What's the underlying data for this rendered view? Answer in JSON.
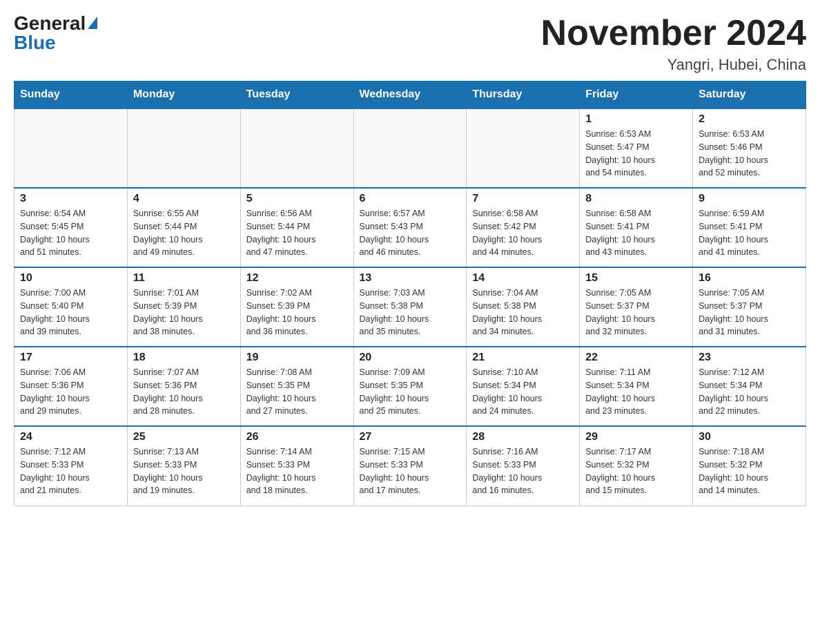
{
  "header": {
    "logo_general": "General",
    "logo_blue": "Blue",
    "month_title": "November 2024",
    "location": "Yangri, Hubei, China"
  },
  "days_of_week": [
    "Sunday",
    "Monday",
    "Tuesday",
    "Wednesday",
    "Thursday",
    "Friday",
    "Saturday"
  ],
  "weeks": [
    [
      {
        "day": "",
        "info": ""
      },
      {
        "day": "",
        "info": ""
      },
      {
        "day": "",
        "info": ""
      },
      {
        "day": "",
        "info": ""
      },
      {
        "day": "",
        "info": ""
      },
      {
        "day": "1",
        "info": "Sunrise: 6:53 AM\nSunset: 5:47 PM\nDaylight: 10 hours\nand 54 minutes."
      },
      {
        "day": "2",
        "info": "Sunrise: 6:53 AM\nSunset: 5:46 PM\nDaylight: 10 hours\nand 52 minutes."
      }
    ],
    [
      {
        "day": "3",
        "info": "Sunrise: 6:54 AM\nSunset: 5:45 PM\nDaylight: 10 hours\nand 51 minutes."
      },
      {
        "day": "4",
        "info": "Sunrise: 6:55 AM\nSunset: 5:44 PM\nDaylight: 10 hours\nand 49 minutes."
      },
      {
        "day": "5",
        "info": "Sunrise: 6:56 AM\nSunset: 5:44 PM\nDaylight: 10 hours\nand 47 minutes."
      },
      {
        "day": "6",
        "info": "Sunrise: 6:57 AM\nSunset: 5:43 PM\nDaylight: 10 hours\nand 46 minutes."
      },
      {
        "day": "7",
        "info": "Sunrise: 6:58 AM\nSunset: 5:42 PM\nDaylight: 10 hours\nand 44 minutes."
      },
      {
        "day": "8",
        "info": "Sunrise: 6:58 AM\nSunset: 5:41 PM\nDaylight: 10 hours\nand 43 minutes."
      },
      {
        "day": "9",
        "info": "Sunrise: 6:59 AM\nSunset: 5:41 PM\nDaylight: 10 hours\nand 41 minutes."
      }
    ],
    [
      {
        "day": "10",
        "info": "Sunrise: 7:00 AM\nSunset: 5:40 PM\nDaylight: 10 hours\nand 39 minutes."
      },
      {
        "day": "11",
        "info": "Sunrise: 7:01 AM\nSunset: 5:39 PM\nDaylight: 10 hours\nand 38 minutes."
      },
      {
        "day": "12",
        "info": "Sunrise: 7:02 AM\nSunset: 5:39 PM\nDaylight: 10 hours\nand 36 minutes."
      },
      {
        "day": "13",
        "info": "Sunrise: 7:03 AM\nSunset: 5:38 PM\nDaylight: 10 hours\nand 35 minutes."
      },
      {
        "day": "14",
        "info": "Sunrise: 7:04 AM\nSunset: 5:38 PM\nDaylight: 10 hours\nand 34 minutes."
      },
      {
        "day": "15",
        "info": "Sunrise: 7:05 AM\nSunset: 5:37 PM\nDaylight: 10 hours\nand 32 minutes."
      },
      {
        "day": "16",
        "info": "Sunrise: 7:05 AM\nSunset: 5:37 PM\nDaylight: 10 hours\nand 31 minutes."
      }
    ],
    [
      {
        "day": "17",
        "info": "Sunrise: 7:06 AM\nSunset: 5:36 PM\nDaylight: 10 hours\nand 29 minutes."
      },
      {
        "day": "18",
        "info": "Sunrise: 7:07 AM\nSunset: 5:36 PM\nDaylight: 10 hours\nand 28 minutes."
      },
      {
        "day": "19",
        "info": "Sunrise: 7:08 AM\nSunset: 5:35 PM\nDaylight: 10 hours\nand 27 minutes."
      },
      {
        "day": "20",
        "info": "Sunrise: 7:09 AM\nSunset: 5:35 PM\nDaylight: 10 hours\nand 25 minutes."
      },
      {
        "day": "21",
        "info": "Sunrise: 7:10 AM\nSunset: 5:34 PM\nDaylight: 10 hours\nand 24 minutes."
      },
      {
        "day": "22",
        "info": "Sunrise: 7:11 AM\nSunset: 5:34 PM\nDaylight: 10 hours\nand 23 minutes."
      },
      {
        "day": "23",
        "info": "Sunrise: 7:12 AM\nSunset: 5:34 PM\nDaylight: 10 hours\nand 22 minutes."
      }
    ],
    [
      {
        "day": "24",
        "info": "Sunrise: 7:12 AM\nSunset: 5:33 PM\nDaylight: 10 hours\nand 21 minutes."
      },
      {
        "day": "25",
        "info": "Sunrise: 7:13 AM\nSunset: 5:33 PM\nDaylight: 10 hours\nand 19 minutes."
      },
      {
        "day": "26",
        "info": "Sunrise: 7:14 AM\nSunset: 5:33 PM\nDaylight: 10 hours\nand 18 minutes."
      },
      {
        "day": "27",
        "info": "Sunrise: 7:15 AM\nSunset: 5:33 PM\nDaylight: 10 hours\nand 17 minutes."
      },
      {
        "day": "28",
        "info": "Sunrise: 7:16 AM\nSunset: 5:33 PM\nDaylight: 10 hours\nand 16 minutes."
      },
      {
        "day": "29",
        "info": "Sunrise: 7:17 AM\nSunset: 5:32 PM\nDaylight: 10 hours\nand 15 minutes."
      },
      {
        "day": "30",
        "info": "Sunrise: 7:18 AM\nSunset: 5:32 PM\nDaylight: 10 hours\nand 14 minutes."
      }
    ]
  ]
}
